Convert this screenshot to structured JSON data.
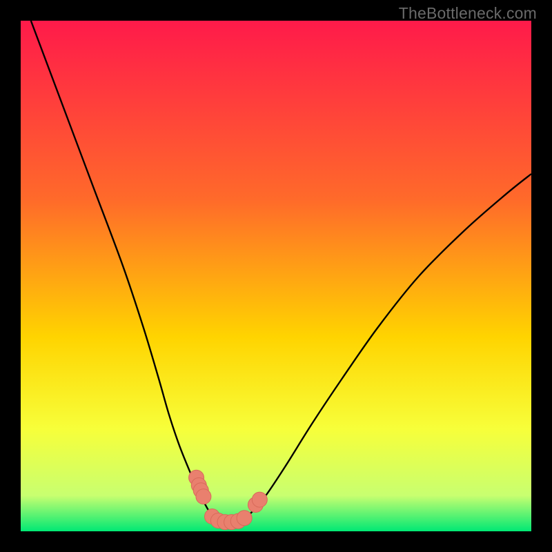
{
  "watermark": "TheBottleneck.com",
  "colors": {
    "frame": "#000000",
    "grad_top": "#ff1a4a",
    "grad_mid1": "#ff6a2a",
    "grad_mid2": "#ffd400",
    "grad_mid3": "#f7ff3a",
    "grad_bot1": "#c8ff70",
    "grad_bot2": "#00e874",
    "curve": "#000000",
    "marker_fill": "#e9806e",
    "marker_stroke": "#d86a5a"
  },
  "chart_data": {
    "type": "line",
    "title": "",
    "xlabel": "",
    "ylabel": "",
    "xlim": [
      0,
      100
    ],
    "ylim": [
      0,
      100
    ],
    "series": [
      {
        "name": "left-curve",
        "x": [
          2,
          8,
          14,
          20,
          24,
          27,
          29,
          31,
          33,
          34.5,
          36,
          37.5,
          39
        ],
        "y": [
          100,
          84,
          68,
          52,
          40,
          30,
          23,
          17,
          12,
          8.5,
          5.5,
          3,
          2
        ]
      },
      {
        "name": "right-curve",
        "x": [
          43,
          45,
          48,
          52,
          57,
          63,
          70,
          78,
          87,
          95,
          100
        ],
        "y": [
          2,
          3.5,
          7,
          13,
          21,
          30,
          40,
          50,
          59,
          66,
          70
        ]
      },
      {
        "name": "valley-floor",
        "x": [
          39,
          41,
          43
        ],
        "y": [
          2,
          1.7,
          2
        ]
      }
    ],
    "markers": {
      "left_cluster": [
        {
          "x": 34.4,
          "y": 10.5
        },
        {
          "x": 34.9,
          "y": 9.0
        },
        {
          "x": 35.3,
          "y": 8.0
        },
        {
          "x": 35.8,
          "y": 6.8
        }
      ],
      "valley_cluster": [
        {
          "x": 37.5,
          "y": 2.9
        },
        {
          "x": 38.7,
          "y": 2.1
        },
        {
          "x": 40.0,
          "y": 1.8
        },
        {
          "x": 41.3,
          "y": 1.8
        },
        {
          "x": 42.6,
          "y": 2.0
        },
        {
          "x": 43.8,
          "y": 2.6
        }
      ],
      "right_cluster": [
        {
          "x": 46.0,
          "y": 5.2
        },
        {
          "x": 46.8,
          "y": 6.2
        }
      ]
    }
  }
}
